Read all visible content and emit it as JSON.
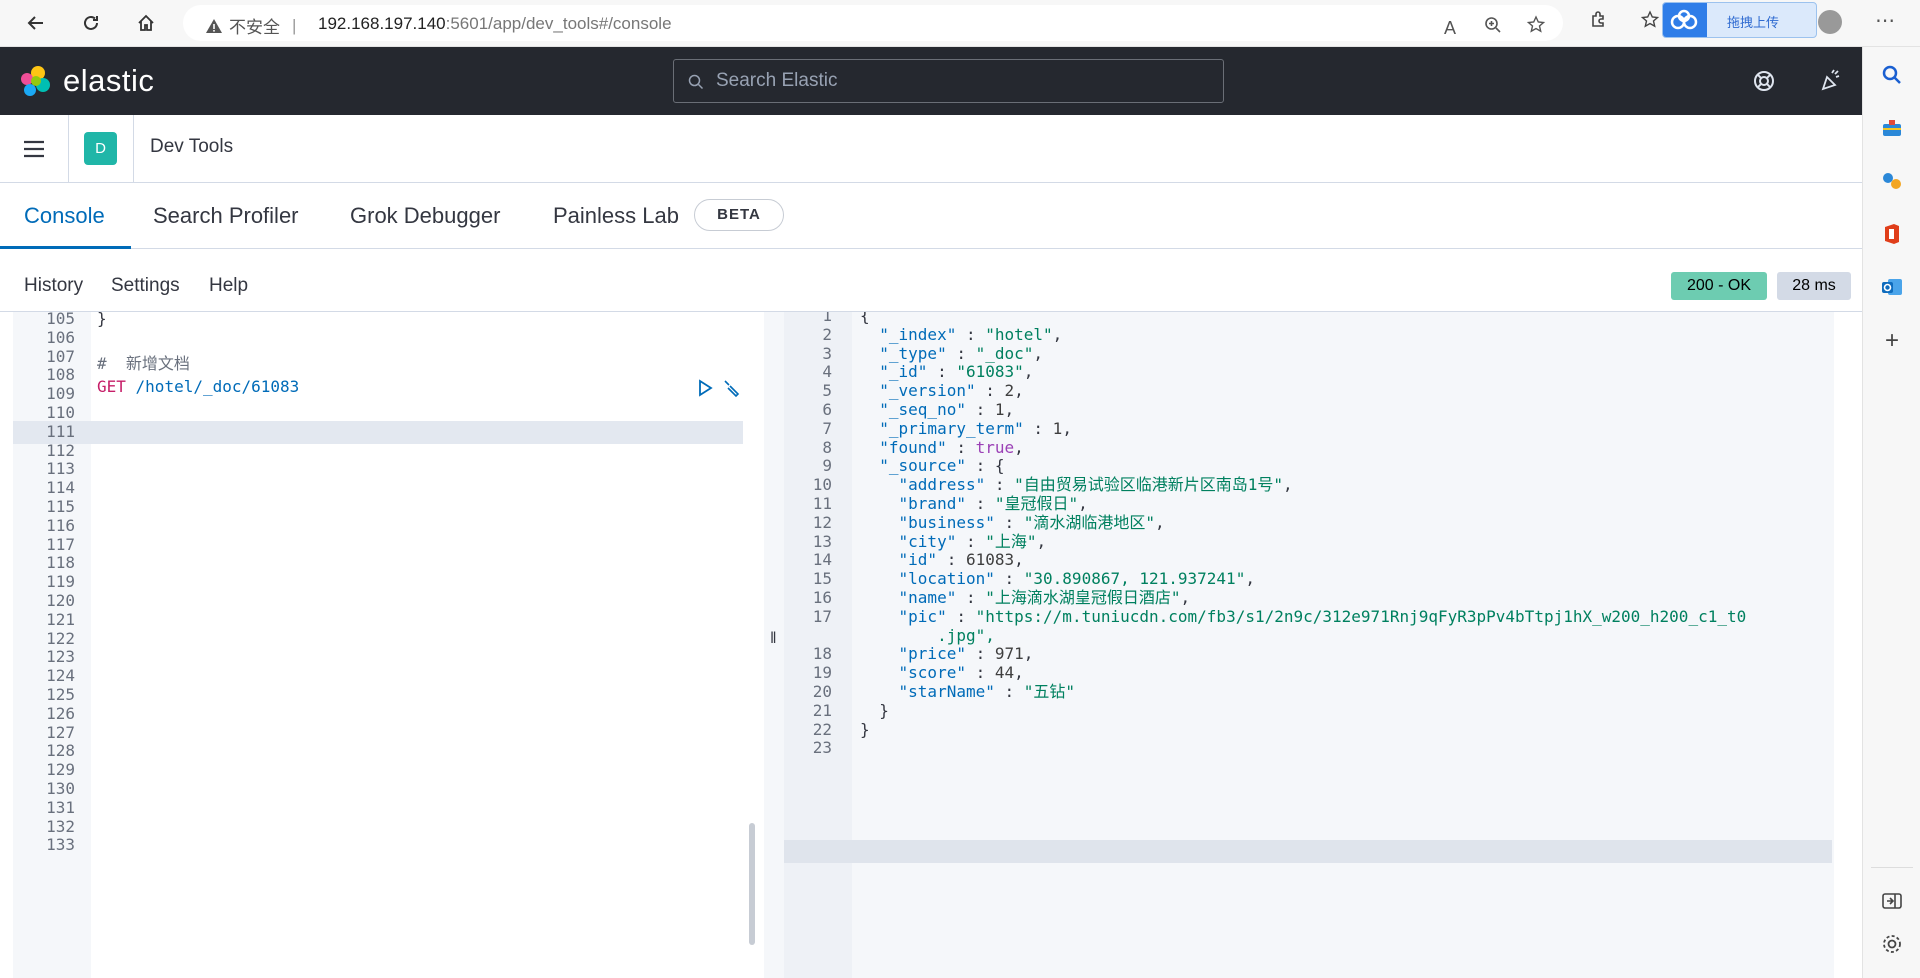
{
  "browser": {
    "insecure_label": "不安全",
    "url_host": "192.168.197.140",
    "url_rest": ":5601/app/dev_tools#/console",
    "upload_label": "拖拽上传"
  },
  "header": {
    "logo_text": "elastic",
    "search_placeholder": "Search Elastic"
  },
  "app": {
    "badge": "D",
    "title": "Dev Tools"
  },
  "tabs": [
    {
      "label": "Console"
    },
    {
      "label": "Search Profiler"
    },
    {
      "label": "Grok Debugger"
    },
    {
      "label": "Painless Lab"
    }
  ],
  "beta_badge": "BETA",
  "toolbar": {
    "history": "History",
    "settings": "Settings",
    "help": "Help",
    "status": "200 - OK",
    "time": "28 ms"
  },
  "left_editor": {
    "line_numbers": [
      "105",
      "106",
      "107",
      "108",
      "109",
      "110",
      "111",
      "112",
      "113",
      "114",
      "115",
      "116",
      "117",
      "118",
      "119",
      "120",
      "121",
      "122",
      "123",
      "124",
      "125",
      "126",
      "127",
      "128",
      "129",
      "130",
      "131",
      "132",
      "133"
    ],
    "close_brace": "}",
    "comment": "#  新增文档",
    "method": "GET",
    "path": " /hotel/_doc/61083"
  },
  "right_editor": {
    "line_numbers": [
      "1",
      "2",
      "3",
      "4",
      "5",
      "6",
      "7",
      "8",
      "9",
      "10",
      "11",
      "12",
      "13",
      "14",
      "15",
      "16",
      "17",
      "",
      "18",
      "19",
      "20",
      "21",
      "22",
      "23"
    ],
    "lines": [
      "{",
      "  \"_index\" : \"hotel\",",
      "  \"_type\" : \"_doc\",",
      "  \"_id\" : \"61083\",",
      "  \"_version\" : 2,",
      "  \"_seq_no\" : 1,",
      "  \"_primary_term\" : 1,",
      "  \"found\" : true,",
      "  \"_source\" : {",
      "    \"address\" : \"自由贸易试验区临港新片区南岛1号\",",
      "    \"brand\" : \"皇冠假日\",",
      "    \"business\" : \"滴水湖临港地区\",",
      "    \"city\" : \"上海\",",
      "    \"id\" : 61083,",
      "    \"location\" : \"30.890867, 121.937241\",",
      "    \"name\" : \"上海滴水湖皇冠假日酒店\",",
      "    \"pic\" : \"https://m.tuniucdn.com/fb3/s1/2n9c/312e971Rnj9qFyR3pPv4bTtpj1hX_w200_h200_c1_t0",
      "        .jpg\",",
      "    \"price\" : 971,",
      "    \"score\" : 44,",
      "    \"starName\" : \"五钻\"",
      "  }",
      "}",
      ""
    ]
  },
  "colors": {
    "header_bg": "#25282f",
    "accent": "#006bb8",
    "status_ok": "#6dccb1",
    "app_badge": "#20b6a8"
  }
}
